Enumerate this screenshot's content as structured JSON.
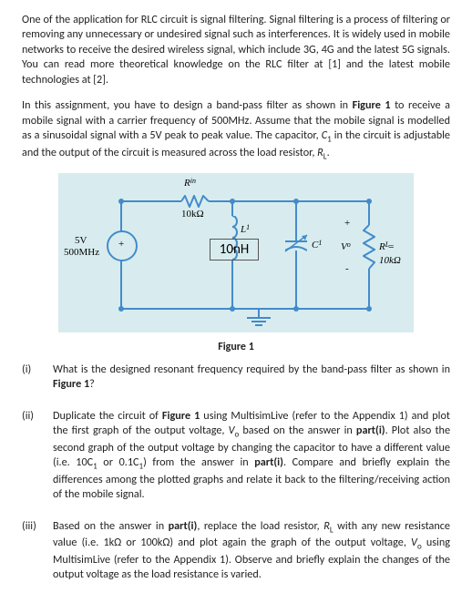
{
  "intro": {
    "p1": "One of the application for RLC circuit is signal filtering. Signal filtering is a process of filtering or removing any unnecessary or undesired signal such as interferences. It is widely used in mobile networks to receive the desired wireless signal, which include 3G, 4G and the latest 5G signals. You can read more theoretical knowledge on the RLC filter at [1] and the latest mobile technologies at [2].",
    "p2_a": "In this assignment, you have to design a band-pass filter as shown in ",
    "p2_b": "Figure 1",
    "p2_c": " to receive a mobile signal with a carrier frequency of 500MHz. Assume that the mobile signal is modelled as a sinusoidal signal with a 5V peak to peak value. The capacitor, ",
    "p2_d": "C",
    "p2_e": "1",
    "p2_f": " in the circuit is adjustable and the output of the circuit is measured across the load resistor, ",
    "p2_g": "R",
    "p2_h": "L",
    "p2_i": "."
  },
  "circuit": {
    "Rin_label": "Rin",
    "Rin_val": "10kΩ",
    "Vs_top": "5V",
    "Vs_bot": "500MHz",
    "L_label": "L1",
    "L_val": "10nH",
    "C_label": "C1",
    "Vo_label": "Vo",
    "RL_label": "RL = 10kΩ",
    "plus": "+",
    "minus": "-"
  },
  "figure_caption": "Figure 1",
  "questions": {
    "q1": {
      "num": "(i)",
      "a": "What is the designed resonant frequency required by the band-pass filter as shown in ",
      "b": "Figure 1",
      "c": "?"
    },
    "q2": {
      "num": "(ii)",
      "a": "Duplicate the circuit of ",
      "b": "Figure 1",
      "c": " using MultisimLive (refer to the Appendix 1) and plot the first graph of the output voltage, ",
      "d": "V",
      "e": "o",
      "f": " based on the answer in ",
      "g": "part(i)",
      "h": ". Plot also the second graph of the output voltage by changing the capacitor to have a different value (i.e. 10C",
      "i": "1",
      "j": " or 0.1C",
      "k": "1",
      "l": ") from the answer in ",
      "m": "part(i)",
      "n": ". Compare and briefly explain the differences among the plotted graphs and relate it back to the filtering/receiving action of the mobile signal."
    },
    "q3": {
      "num": "(iii)",
      "a": "Based on the answer in ",
      "b": "part(i)",
      "c": ", replace the load resistor, ",
      "d": "R",
      "e": "L",
      "f": " with any new resistance value (i.e. 1kΩ or 100kΩ) and plot again the graph of the output voltage, ",
      "g": "V",
      "h": "o",
      "i": " using MultisimLive (refer to the Appendix 1). Observe and briefly explain the changes of the output voltage as the load resistance is varied."
    }
  }
}
